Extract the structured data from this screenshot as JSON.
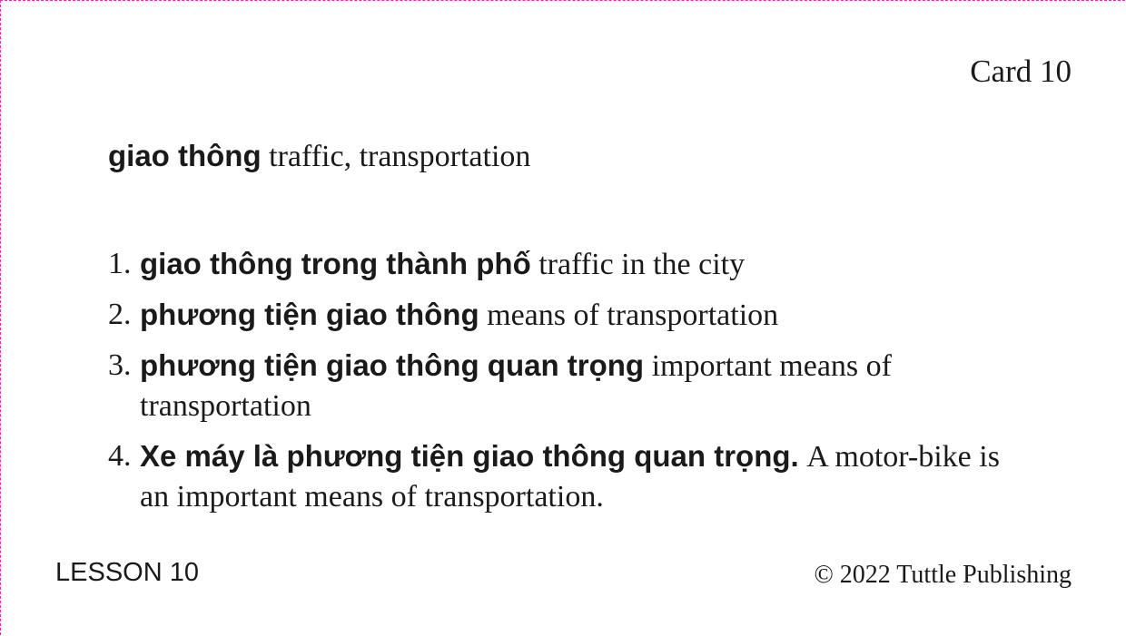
{
  "card": {
    "number_label": "Card 10",
    "headword": "giao thông",
    "headword_translation": "traffic, transportation",
    "examples": [
      {
        "num": "1.",
        "vi": "giao thông trong thành phố",
        "en": "traffic in the city"
      },
      {
        "num": "2.",
        "vi": "phương tiện giao thông",
        "en": "means of transportation"
      },
      {
        "num": "3.",
        "vi": "phương tiện giao thông quan trọng",
        "en": "important means of transportation"
      },
      {
        "num": "4.",
        "vi": "Xe máy là phương tiện giao thông quan trọng.",
        "en": "A motor-bike is an important means of transportation."
      }
    ],
    "lesson_label": "LESSON 10",
    "copyright": "© 2022 Tuttle Publishing"
  },
  "colors": {
    "border": "#d63aa0",
    "text": "#1a1a1a",
    "background": "#ffffff"
  }
}
